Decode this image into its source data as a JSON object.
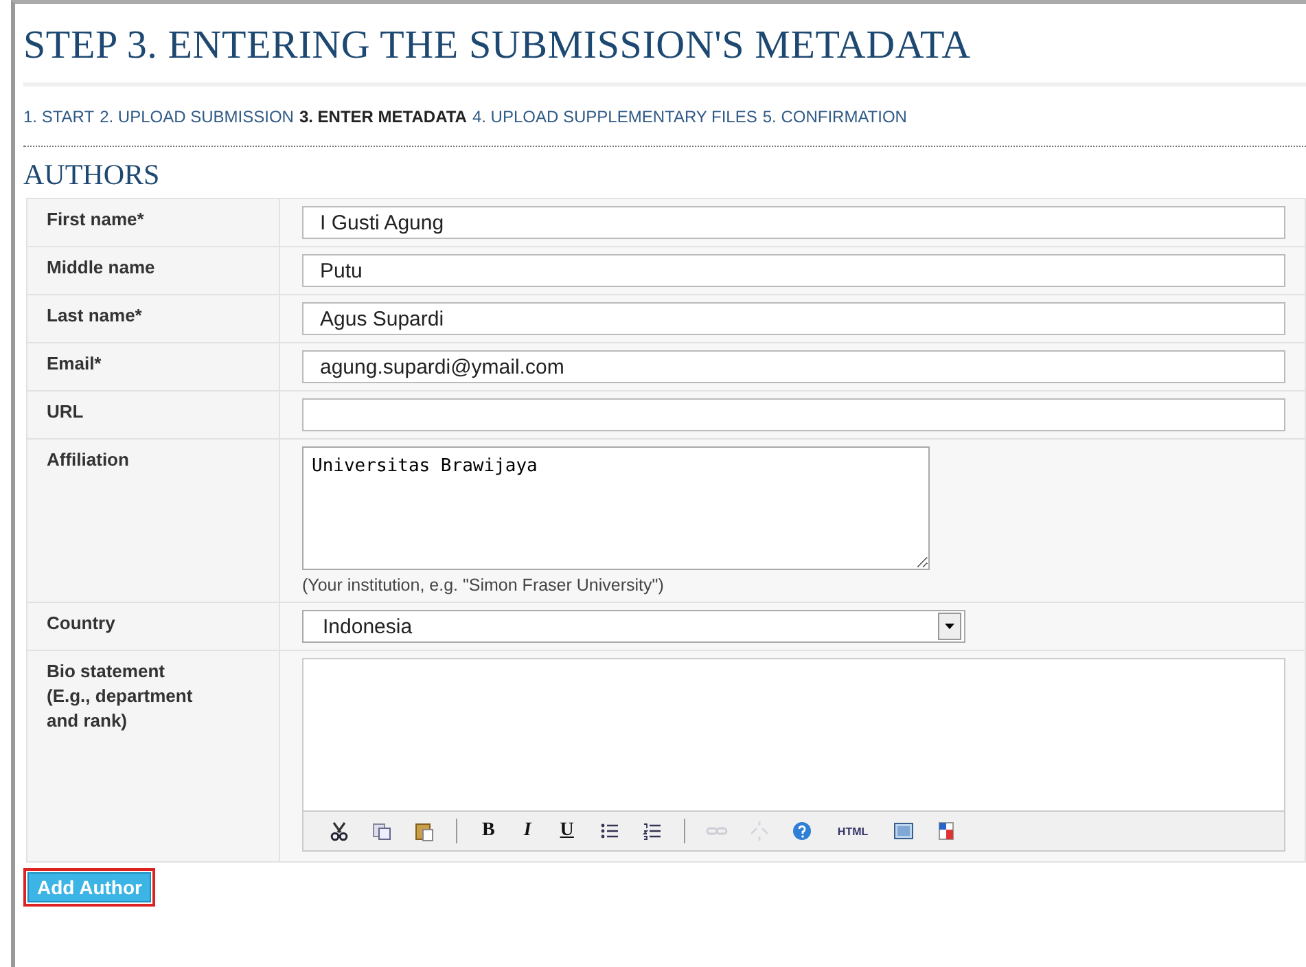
{
  "title": "STEP 3. ENTERING THE SUBMISSION'S METADATA",
  "steps": [
    {
      "label": "1. START",
      "selected": false
    },
    {
      "label": "2. UPLOAD SUBMISSION",
      "selected": false
    },
    {
      "label": "3. ENTER METADATA",
      "selected": true
    },
    {
      "label": "4. UPLOAD SUPPLEMENTARY FILES",
      "selected": false
    },
    {
      "label": "5. CONFIRMATION",
      "selected": false
    }
  ],
  "section_title": "AUTHORS",
  "fields": [
    {
      "kind": "text",
      "label": "First name*",
      "value": "I Gusti Agung"
    },
    {
      "kind": "text",
      "label": "Middle name",
      "value": "Putu"
    },
    {
      "kind": "text",
      "label": "Last name*",
      "value": "Agus Supardi"
    },
    {
      "kind": "text",
      "label": "Email*",
      "value": "agung.supardi@ymail.com"
    },
    {
      "kind": "text",
      "label": "URL"
    },
    {
      "kind": "textarea",
      "label": "Affiliation",
      "value": "Universitas Brawijaya",
      "hint": "(Your institution, e.g. \"Simon Fraser University\")"
    },
    {
      "kind": "select",
      "label": "Country",
      "value": "Indonesia"
    },
    {
      "kind": "editor",
      "label": "Bio statement (E.g., department and rank)"
    }
  ],
  "editor_toolbar": [
    {
      "kind": "icon",
      "disabled": false
    },
    {
      "kind": "icon",
      "disabled": false
    },
    {
      "kind": "icon",
      "disabled": false
    },
    {
      "kind": "separator"
    },
    {
      "kind": "text",
      "text": "B",
      "disabled": false
    },
    {
      "kind": "text",
      "text": "I",
      "disabled": false
    },
    {
      "kind": "text",
      "text": "U",
      "disabled": false
    },
    {
      "kind": "icon",
      "disabled": false
    },
    {
      "kind": "icon",
      "disabled": false
    },
    {
      "kind": "separator"
    },
    {
      "kind": "icon",
      "disabled": true
    },
    {
      "kind": "icon",
      "disabled": true
    },
    {
      "kind": "icon",
      "disabled": false
    },
    {
      "kind": "text",
      "text": "HTML",
      "disabled": false
    },
    {
      "kind": "icon",
      "disabled": false
    },
    {
      "kind": "icon",
      "disabled": false
    }
  ],
  "add_button": {
    "label": "Add Author",
    "highlighted": true
  }
}
